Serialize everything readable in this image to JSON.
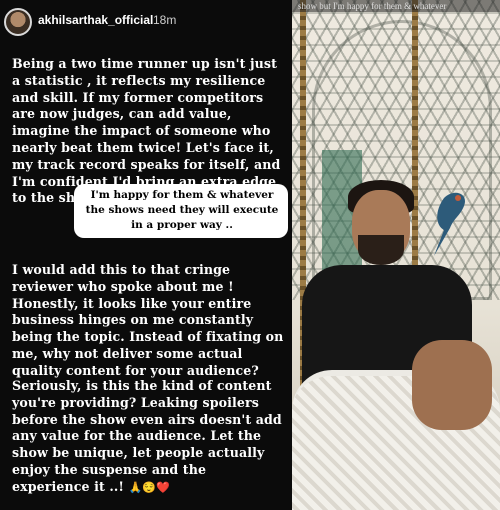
{
  "story": {
    "username": "akhilsarthak_official",
    "time": "18m",
    "paragraph1": "Being a two time runner up isn't just a statistic , it reflects my resilience and skill. If my former competitors are now judges, can add value, imagine the impact of someone who nearly beat them twice! Let's face it, my track record speaks for itself, and I'm confident I'd bring an extra edge to the show but",
    "bubble": "I'm happy for them & whatever the shows need they will execute in a proper way ..",
    "paragraph2": "I would add this to that cringe reviewer who spoke about me ! Honestly, it looks like your entire business hinges on me constantly being the topic. Instead of fixating on me, why not deliver some actual quality content for your audience?",
    "paragraph3": "Seriously, is this the kind of content you're providing? Leaking spoilers before the show even airs doesn't add any value for the audience. Let the show be unique, let people actually enjoy the suspense and the experience it ..!",
    "paragraph3_emojis": "🙏😌❤️"
  },
  "photo": {
    "overlay_text": "show but I'm happy for them & whatever"
  }
}
